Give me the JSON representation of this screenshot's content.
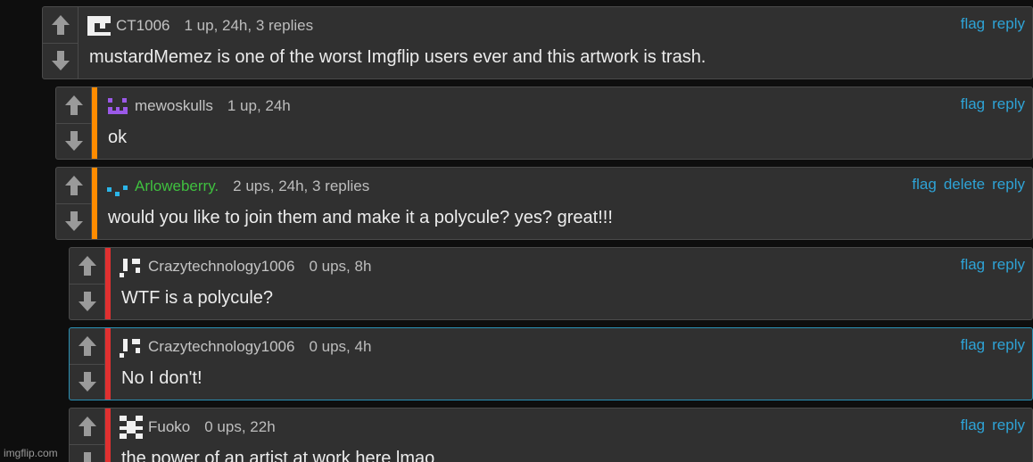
{
  "comments": [
    {
      "username": "CT1006",
      "stats": "1 up, 24h, 3 replies",
      "text": "mustardMemez is one of the worst Imgflip users ever and this artwork is trash.",
      "actions": [
        "flag",
        "reply"
      ],
      "avatar_icon": "white-pixel-avatar-icon"
    },
    {
      "username": "mewoskulls",
      "stats": "1 up, 24h",
      "text": "ok",
      "actions": [
        "flag",
        "reply"
      ],
      "depth_color": "#ff8c00",
      "avatar_icon": "purple-pixel-face-icon"
    },
    {
      "username": "Arloweberry.",
      "stats": "2 ups, 24h, 3 replies",
      "text": "would you like to join them and make it a polycule? yes? great!!!",
      "actions": [
        "flag",
        "delete",
        "reply"
      ],
      "depth_color": "#ff8c00",
      "username_color": "#3fc03f",
      "avatar_icon": "blue-pixel-face-icon"
    },
    {
      "username": "Crazytechnology1006",
      "stats": "0 ups, 8h",
      "text": "WTF is a polycule?",
      "actions": [
        "flag",
        "reply"
      ],
      "depth_color": "#e03030",
      "avatar_icon": "white-pixel-avatar-icon"
    },
    {
      "username": "Crazytechnology1006",
      "stats": "0 ups, 4h",
      "text": "No I don't!",
      "actions": [
        "flag",
        "reply"
      ],
      "depth_color": "#e03030",
      "highlight_color": "#2a8fb3",
      "avatar_icon": "white-pixel-avatar-icon"
    },
    {
      "username": "Fuoko",
      "stats": "0 ups, 22h",
      "text": "the power of an artist at work here lmao",
      "actions": [
        "flag",
        "reply"
      ],
      "depth_color": "#e03030",
      "avatar_icon": "white-pixel-pattern-icon"
    }
  ],
  "watermark": "imgflip.com"
}
